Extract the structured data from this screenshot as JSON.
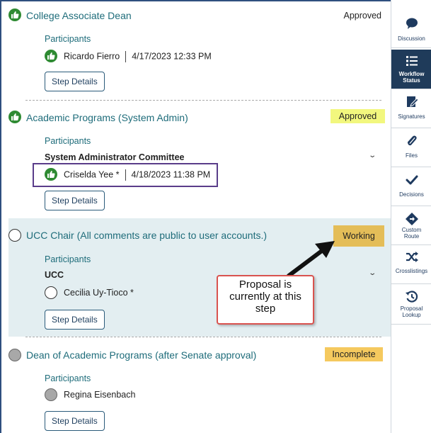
{
  "steps": [
    {
      "title": "College Associate Dean",
      "status": "Approved",
      "participants_label": "Participants",
      "participant_name": "Ricardo Fierro",
      "participant_time": "4/17/2023 12:33 PM",
      "button_label": "Step Details"
    },
    {
      "title": "Academic Programs (System Admin)",
      "status": "Approved",
      "participants_label": "Participants",
      "group": "System Administrator Committee",
      "participant_name": "Criselda Yee *",
      "participant_time": "4/18/2023 11:38 PM",
      "button_label": "Step Details"
    },
    {
      "title": "UCC Chair (All comments are public to user accounts.)",
      "status": "Working",
      "participants_label": "Participants",
      "group": "UCC",
      "participant_name": "Cecilia Uy-Tioco *",
      "button_label": "Step Details"
    },
    {
      "title": "Dean of Academic Programs (after Senate approval)",
      "status": "Incomplete",
      "participants_label": "Participants",
      "participant_name": "Regina Eisenbach",
      "button_label": "Step Details"
    }
  ],
  "callout": {
    "line1": "Proposal is",
    "line2": "currently at this",
    "line3": "step"
  },
  "sidebar": {
    "items": [
      {
        "label": "Discussion",
        "icon": "chat-bubble-icon"
      },
      {
        "label1": "Workflow",
        "label2": "Status",
        "icon": "list-icon",
        "active": true
      },
      {
        "label": "Signatures",
        "icon": "signature-icon"
      },
      {
        "label": "Files",
        "icon": "paperclip-icon"
      },
      {
        "label": "Decisions",
        "icon": "checkmark-icon"
      },
      {
        "label1": "Custom",
        "label2": "Route",
        "icon": "route-diamond-icon"
      },
      {
        "label": "Crosslistings",
        "icon": "shuffle-icon"
      },
      {
        "label1": "Proposal",
        "label2": "Lookup",
        "icon": "history-icon"
      }
    ]
  },
  "colors": {
    "approved_icon": "#2e8a32",
    "title_teal": "#1e6c7a",
    "approved_highlight": "#f2f77e",
    "working_badge": "#e4bd58",
    "incomplete_badge": "#f5c95e",
    "working_row_bg": "#e3eef1",
    "sidebar_active": "#1f3b5a",
    "highlight_box": "#5a3d8a",
    "callout_border": "#d9534f"
  }
}
